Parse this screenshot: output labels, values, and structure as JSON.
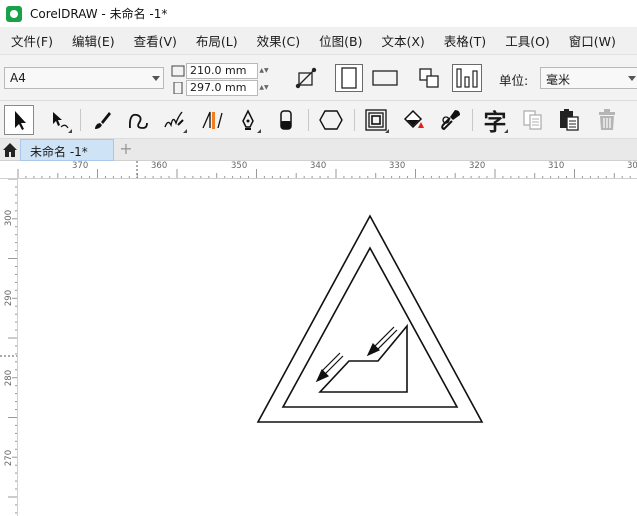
{
  "window": {
    "title": "CorelDRAW - 未命名 -1*"
  },
  "menu": [
    "文件(F)",
    "编辑(E)",
    "查看(V)",
    "布局(L)",
    "效果(C)",
    "位图(B)",
    "文本(X)",
    "表格(T)",
    "工具(O)",
    "窗口(W)"
  ],
  "property_bar": {
    "page_size": "A4",
    "width": "210.0 mm",
    "height": "297.0 mm",
    "unit_label": "单位:",
    "unit_value": "毫米"
  },
  "toolbox": {
    "items": [
      "pick-tool",
      "shape-tool",
      "artistic-media-tool",
      "freehand-tool",
      "smart-fill-tool",
      "measure-tool",
      "pen-tool",
      "eraser-tool",
      "polygon-tool",
      "contour-tool",
      "interactive-fill-tool",
      "eyedropper-tool",
      "text-tool",
      "copy-tool",
      "paste-tool",
      "delete-tool"
    ],
    "text_tool_glyph": "字"
  },
  "tabs": {
    "document": "未命名 -1*",
    "add": "+"
  },
  "ruler": {
    "horizontal": [
      "370",
      "360",
      "350",
      "340",
      "330",
      "320",
      "310",
      "30"
    ],
    "vertical": [
      "300",
      "290",
      "280",
      "270"
    ]
  },
  "colors": {
    "accent": "#17a24a",
    "tab_active": "#cfe3f7",
    "eraser_accent": "#f07d22"
  }
}
